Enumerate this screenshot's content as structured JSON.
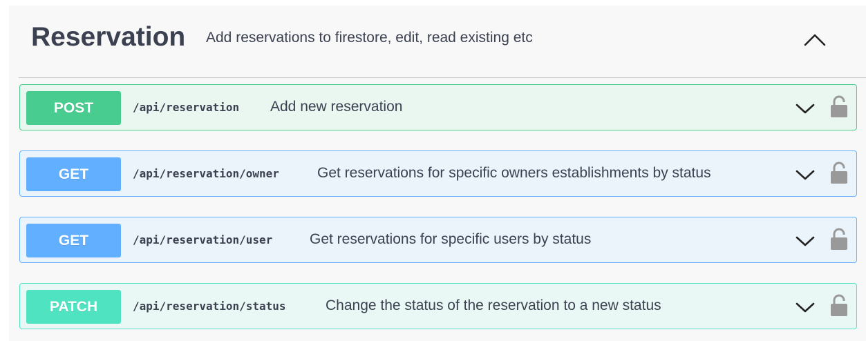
{
  "tag": {
    "title": "Reservation",
    "description": "Add reservations to firestore, edit, read existing etc",
    "collapse_icon": "chevron-up-icon"
  },
  "operations": [
    {
      "method": "POST",
      "path": "/api/reservation",
      "summary": "Add new reservation",
      "color": "#49cc90"
    },
    {
      "method": "GET",
      "path": "/api/reservation/owner",
      "summary": "Get reservations for specific owners establishments by status",
      "color": "#61affe"
    },
    {
      "method": "GET",
      "path": "/api/reservation/user",
      "summary": "Get reservations for specific users by status",
      "color": "#61affe"
    },
    {
      "method": "PATCH",
      "path": "/api/reservation/status",
      "summary": "Change the status of the reservation to a new status",
      "color": "#50e3c2"
    }
  ],
  "icons": {
    "expand": "chevron-down-icon",
    "authorization": "lock-icon"
  }
}
